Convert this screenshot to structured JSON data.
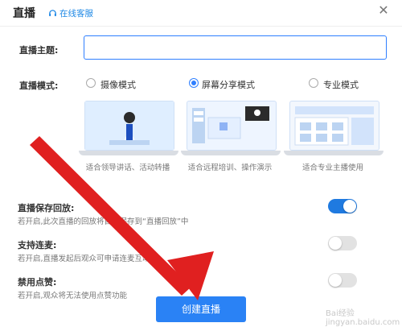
{
  "title": "直播",
  "customer_service": "在线客服",
  "topic": {
    "label": "直播主题:",
    "value": ""
  },
  "mode": {
    "label": "直播模式:",
    "options": [
      {
        "label": "摄像模式",
        "selected": false,
        "caption": "适合领导讲话、活动转播"
      },
      {
        "label": "屏幕分享模式",
        "selected": true,
        "caption": "适合远程培训、操作演示"
      },
      {
        "label": "专业模式",
        "selected": false,
        "caption": "适合专业主播使用"
      }
    ]
  },
  "options": [
    {
      "title": "直播保存回放:",
      "desc": "若开启,此次直播的回放将自动保存到“直播回放”中",
      "on": true
    },
    {
      "title": "支持连麦:",
      "desc": "若开启,直播发起后观众可申请连麦互动",
      "on": false
    },
    {
      "title": "禁用点赞:",
      "desc": "若开启,观众将无法使用点赞功能",
      "on": false
    }
  ],
  "create_button": "创建直播",
  "watermark": "Bai经验 jingyan.baidu.com",
  "colors": {
    "accent": "#2a82f5",
    "arrow": "#e02020"
  }
}
